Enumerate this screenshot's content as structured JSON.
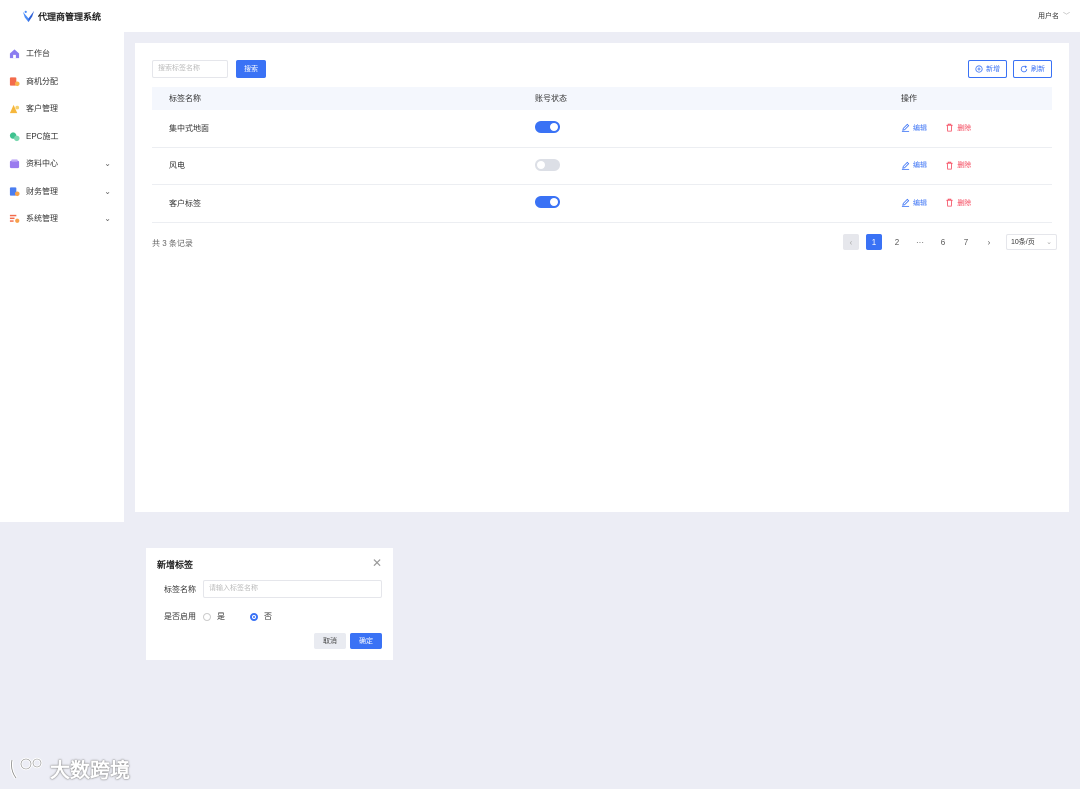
{
  "app": {
    "title": "代理商管理系统",
    "user": "用户名"
  },
  "colors": {
    "primary": "#3a72f5",
    "danger": "#f5475c",
    "background": "#ecedf5"
  },
  "sidebar": {
    "items": [
      {
        "label": "工作台",
        "icon": "home-icon",
        "expandable": false
      },
      {
        "label": "商机分配",
        "icon": "opportunity-icon",
        "expandable": false
      },
      {
        "label": "客户管理",
        "icon": "customer-icon",
        "expandable": false
      },
      {
        "label": "EPC施工",
        "icon": "construction-icon",
        "expandable": false
      },
      {
        "label": "资料中心",
        "icon": "folder-icon",
        "expandable": true
      },
      {
        "label": "财务管理",
        "icon": "finance-icon",
        "expandable": true
      },
      {
        "label": "系统管理",
        "icon": "settings-icon",
        "expandable": true
      }
    ]
  },
  "toolbar": {
    "search_placeholder": "搜索标签名称",
    "search_label": "搜索",
    "add_label": "新增",
    "refresh_label": "刷新"
  },
  "table": {
    "columns": [
      "标签名称",
      "账号状态",
      "操作"
    ],
    "rows": [
      {
        "name": "集中式地面",
        "enabled": true
      },
      {
        "name": "风电",
        "enabled": false
      },
      {
        "name": "客户标签",
        "enabled": true
      }
    ],
    "edit_label": "编辑",
    "delete_label": "删除"
  },
  "pagination": {
    "total_text": "共 3 条记录",
    "pages": [
      "1",
      "2",
      "···",
      "6",
      "7"
    ],
    "current": "1",
    "page_size": "10条/页"
  },
  "dialog": {
    "title": "新增标签",
    "name_label": "标签名称",
    "name_placeholder": "请输入标签名称",
    "enable_label": "是否启用",
    "option_yes": "是",
    "option_no": "否",
    "selected": "否",
    "cancel_label": "取消",
    "ok_label": "确定"
  },
  "watermark": {
    "text": "大数跨境"
  }
}
